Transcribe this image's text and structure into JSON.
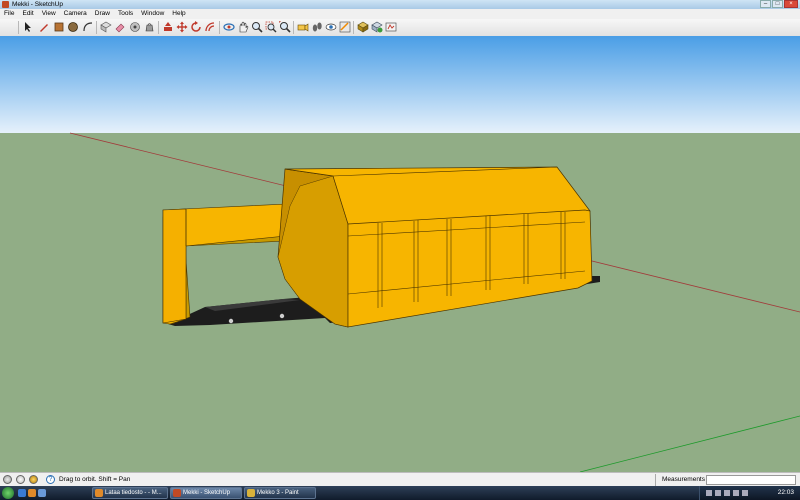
{
  "window": {
    "title": "Mekki - SketchUp",
    "controls": [
      "–",
      "□",
      "×"
    ]
  },
  "menu": [
    "File",
    "Edit",
    "View",
    "Camera",
    "Draw",
    "Tools",
    "Window",
    "Help"
  ],
  "toolbar": {
    "tools": [
      "select-icon",
      "eraser-icon",
      "pencil-icon",
      "rectangle-icon",
      "circle-icon",
      "arc-icon",
      "make-component-icon",
      "paint-bucket-icon",
      "push-pull-icon",
      "follow-me-icon",
      "move-icon",
      "rotate-icon",
      "offset-icon",
      "tape-measure-icon",
      "orbit-icon",
      "pan-icon",
      "zoom-icon",
      "zoom-extents-icon",
      "walkthrough-icon",
      "section-plane-icon",
      "position-camera-icon",
      "look-around-icon",
      "get-models-icon",
      "share-model-icon",
      "component-icon"
    ]
  },
  "scene": {
    "sky_top": "#4a9ee6",
    "sky_bottom": "#e6f1fb",
    "ground": "#91ad86",
    "model_color": "#f7b500",
    "model_shadow": "#c78f00"
  },
  "status": {
    "hint": "Drag to orbit.  Shift = Pan",
    "measurements_label": "Measurements",
    "measurements_value": ""
  },
  "taskbar": {
    "items": [
      {
        "label": "Lataa tiedosto - - M...",
        "active": false
      },
      {
        "label": "Mekki - SketchUp",
        "active": true
      },
      {
        "label": "Mekko 3 - Paint",
        "active": false
      }
    ],
    "clock": "22:03"
  }
}
